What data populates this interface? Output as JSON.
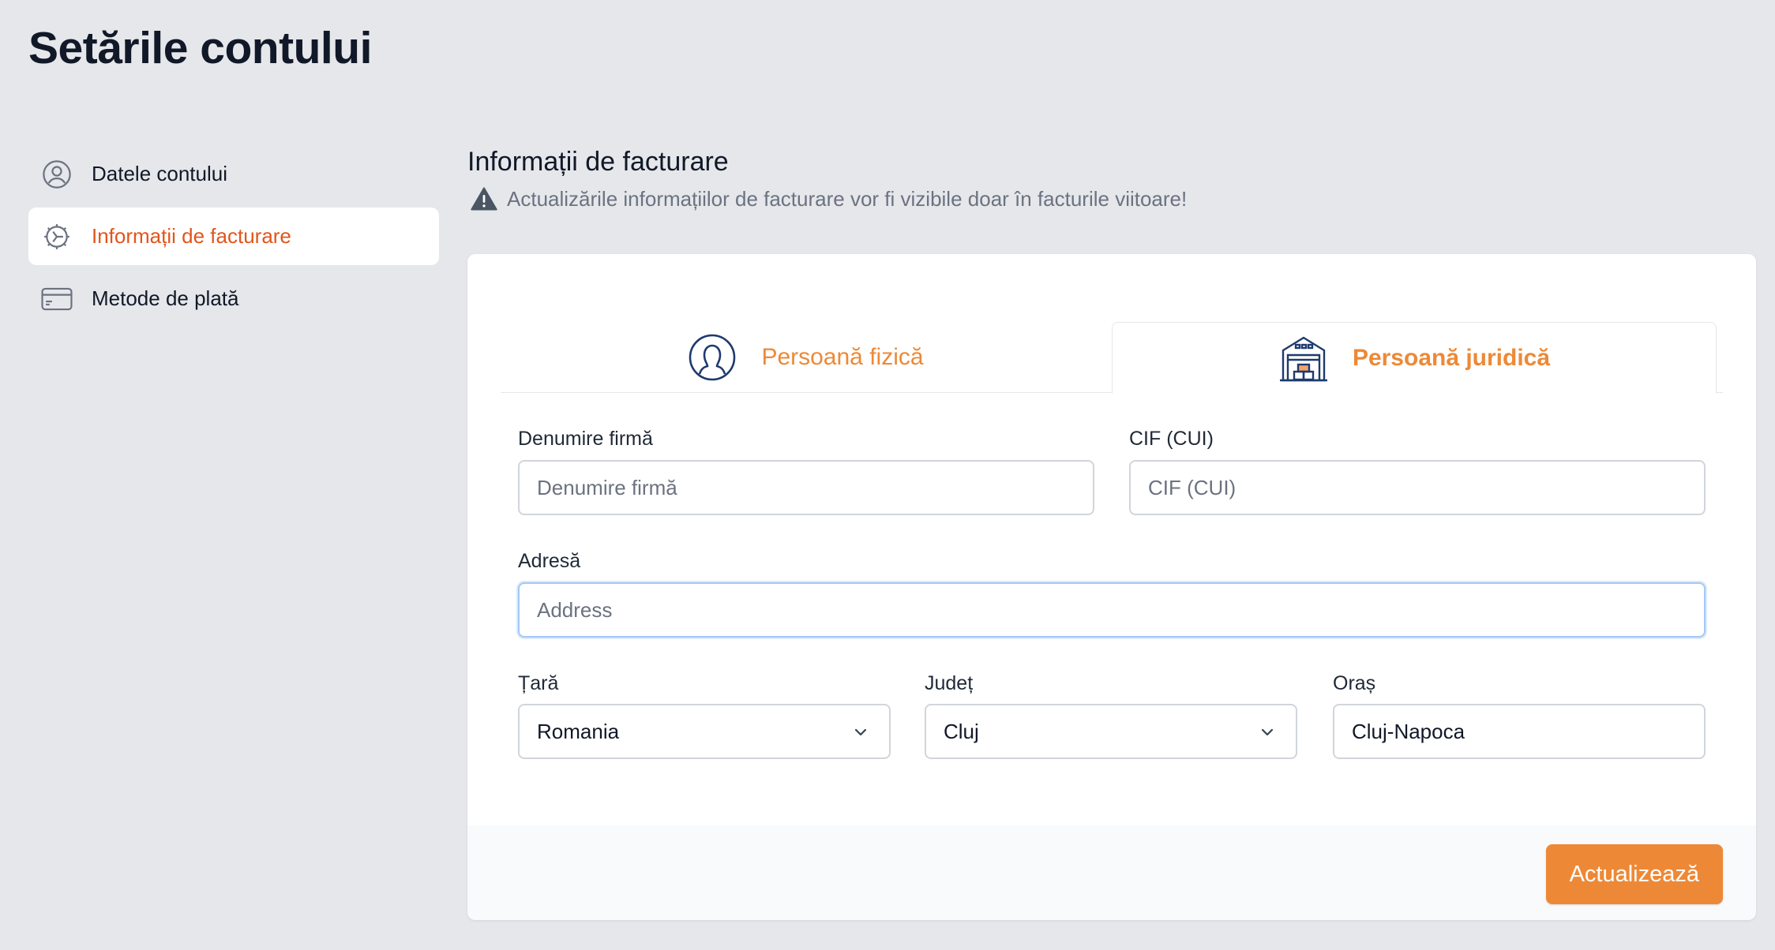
{
  "page": {
    "title": "Setările contului"
  },
  "sidebar": {
    "items": [
      {
        "label": "Datele contului",
        "icon": "user-circle-icon",
        "active": false
      },
      {
        "label": "Informații de facturare",
        "icon": "gear-icon",
        "active": true
      },
      {
        "label": "Metode de plată",
        "icon": "credit-card-icon",
        "active": false
      }
    ]
  },
  "section": {
    "title": "Informații de facturare",
    "note": "Actualizările informațiilor de facturare vor fi vizibile doar în facturile viitoare!",
    "note_icon": "warning-icon"
  },
  "tabs": [
    {
      "label": "Persoană fizică",
      "icon": "person-icon",
      "selected": false
    },
    {
      "label": "Persoană juridică",
      "icon": "warehouse-icon",
      "selected": true
    }
  ],
  "form": {
    "company_name": {
      "label": "Denumire firmă",
      "placeholder": "Denumire firmă",
      "value": ""
    },
    "cif": {
      "label": "CIF (CUI)",
      "placeholder": "CIF (CUI)",
      "value": ""
    },
    "address": {
      "label": "Adresă",
      "placeholder": "Address",
      "value": ""
    },
    "country": {
      "label": "Țară",
      "value": "Romania"
    },
    "county": {
      "label": "Județ",
      "value": "Cluj"
    },
    "city": {
      "label": "Oraș",
      "value": "Cluj-Napoca"
    }
  },
  "actions": {
    "update_label": "Actualizează"
  },
  "colors": {
    "accent": "#ed8936",
    "active_text": "#e2551b",
    "background": "#e5e7eb",
    "icon_navy": "#1e3a6e"
  }
}
